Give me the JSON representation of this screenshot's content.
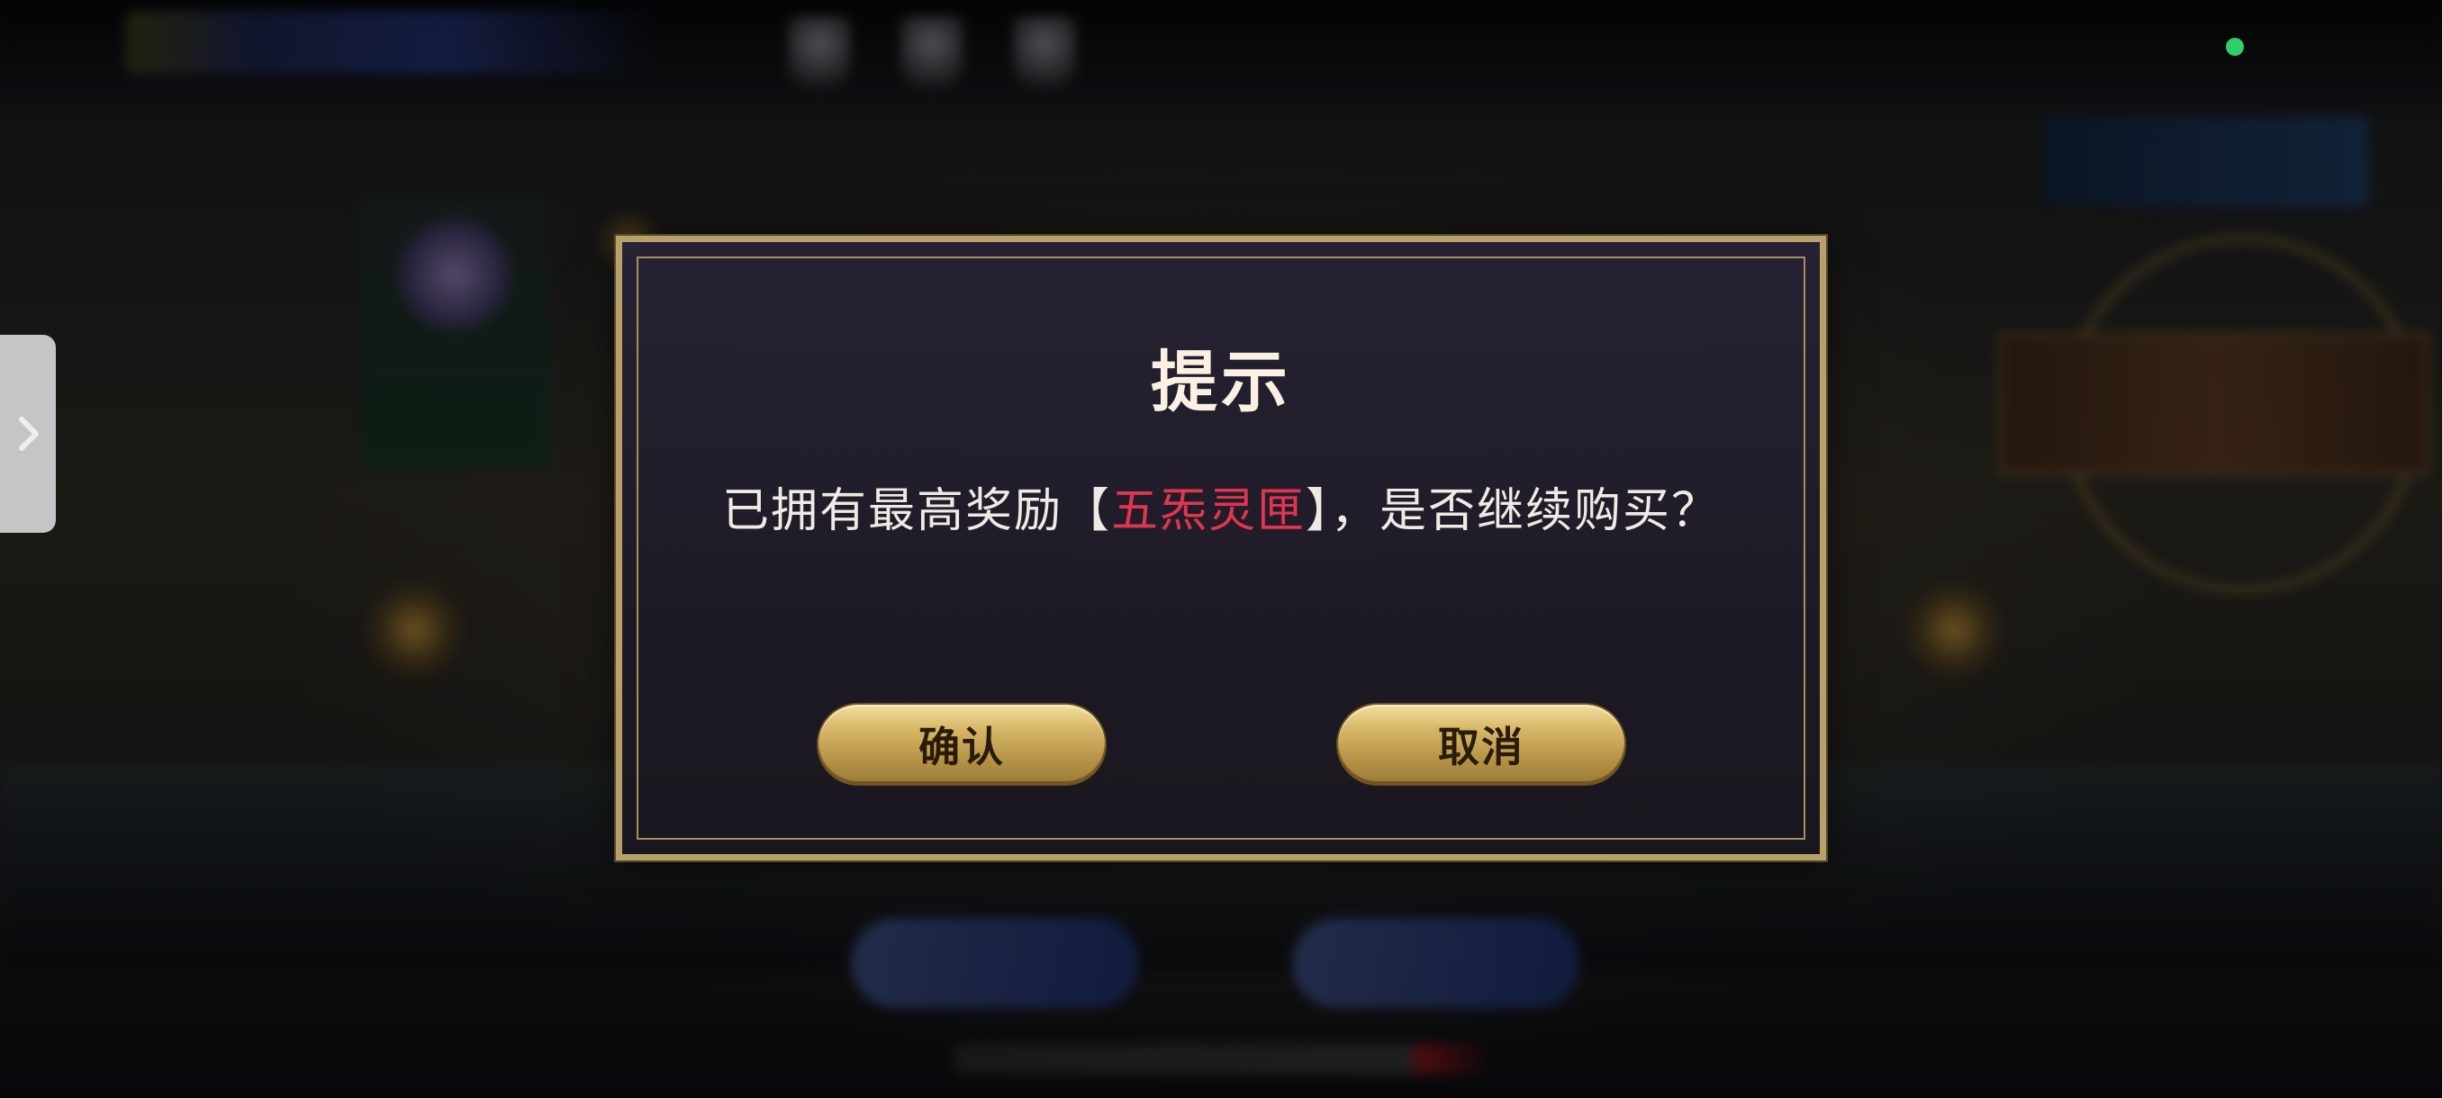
{
  "dialog": {
    "title": "提示",
    "message_prefix": "已拥有最高奖励【",
    "message_highlight": "五炁灵匣",
    "message_suffix": "】，是否继续购买？",
    "confirm_label": "确认",
    "cancel_label": "取消"
  },
  "colors": {
    "highlight": "#e0354e",
    "dialog_border": "#b8a06a",
    "button_gold": "#d8b868",
    "status_dot": "#2fcf6a"
  },
  "icons": {
    "side_tab": "chevron-right-icon"
  }
}
